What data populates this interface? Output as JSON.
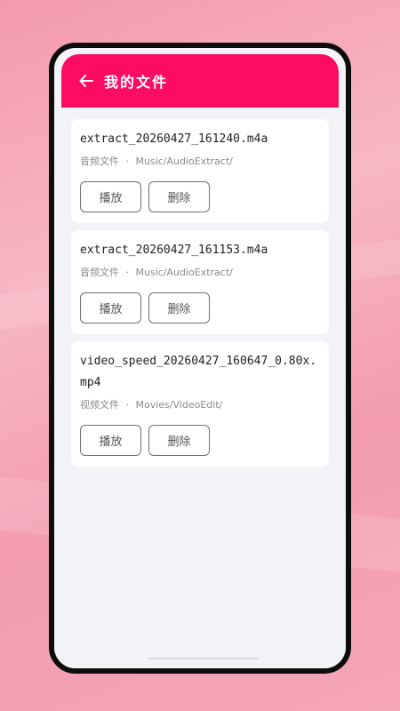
{
  "header": {
    "title": "我的文件",
    "back_icon": "arrow-left-icon"
  },
  "files": [
    {
      "name": "extract_20260427_161240.m4a",
      "type": "音频文件",
      "separator": "·",
      "path": "Music/AudioExtract/",
      "play_label": "播放",
      "delete_label": "删除"
    },
    {
      "name": "extract_20260427_161153.m4a",
      "type": "音频文件",
      "separator": "·",
      "path": "Music/AudioExtract/",
      "play_label": "播放",
      "delete_label": "删除"
    },
    {
      "name": "video_speed_20260427_160647_0.80x.mp4",
      "type": "视频文件",
      "separator": "·",
      "path": "Movies/VideoEdit/",
      "play_label": "播放",
      "delete_label": "删除"
    }
  ],
  "colors": {
    "accent": "#fc0d62",
    "background": "#f3f4f7",
    "card": "#ffffff"
  }
}
